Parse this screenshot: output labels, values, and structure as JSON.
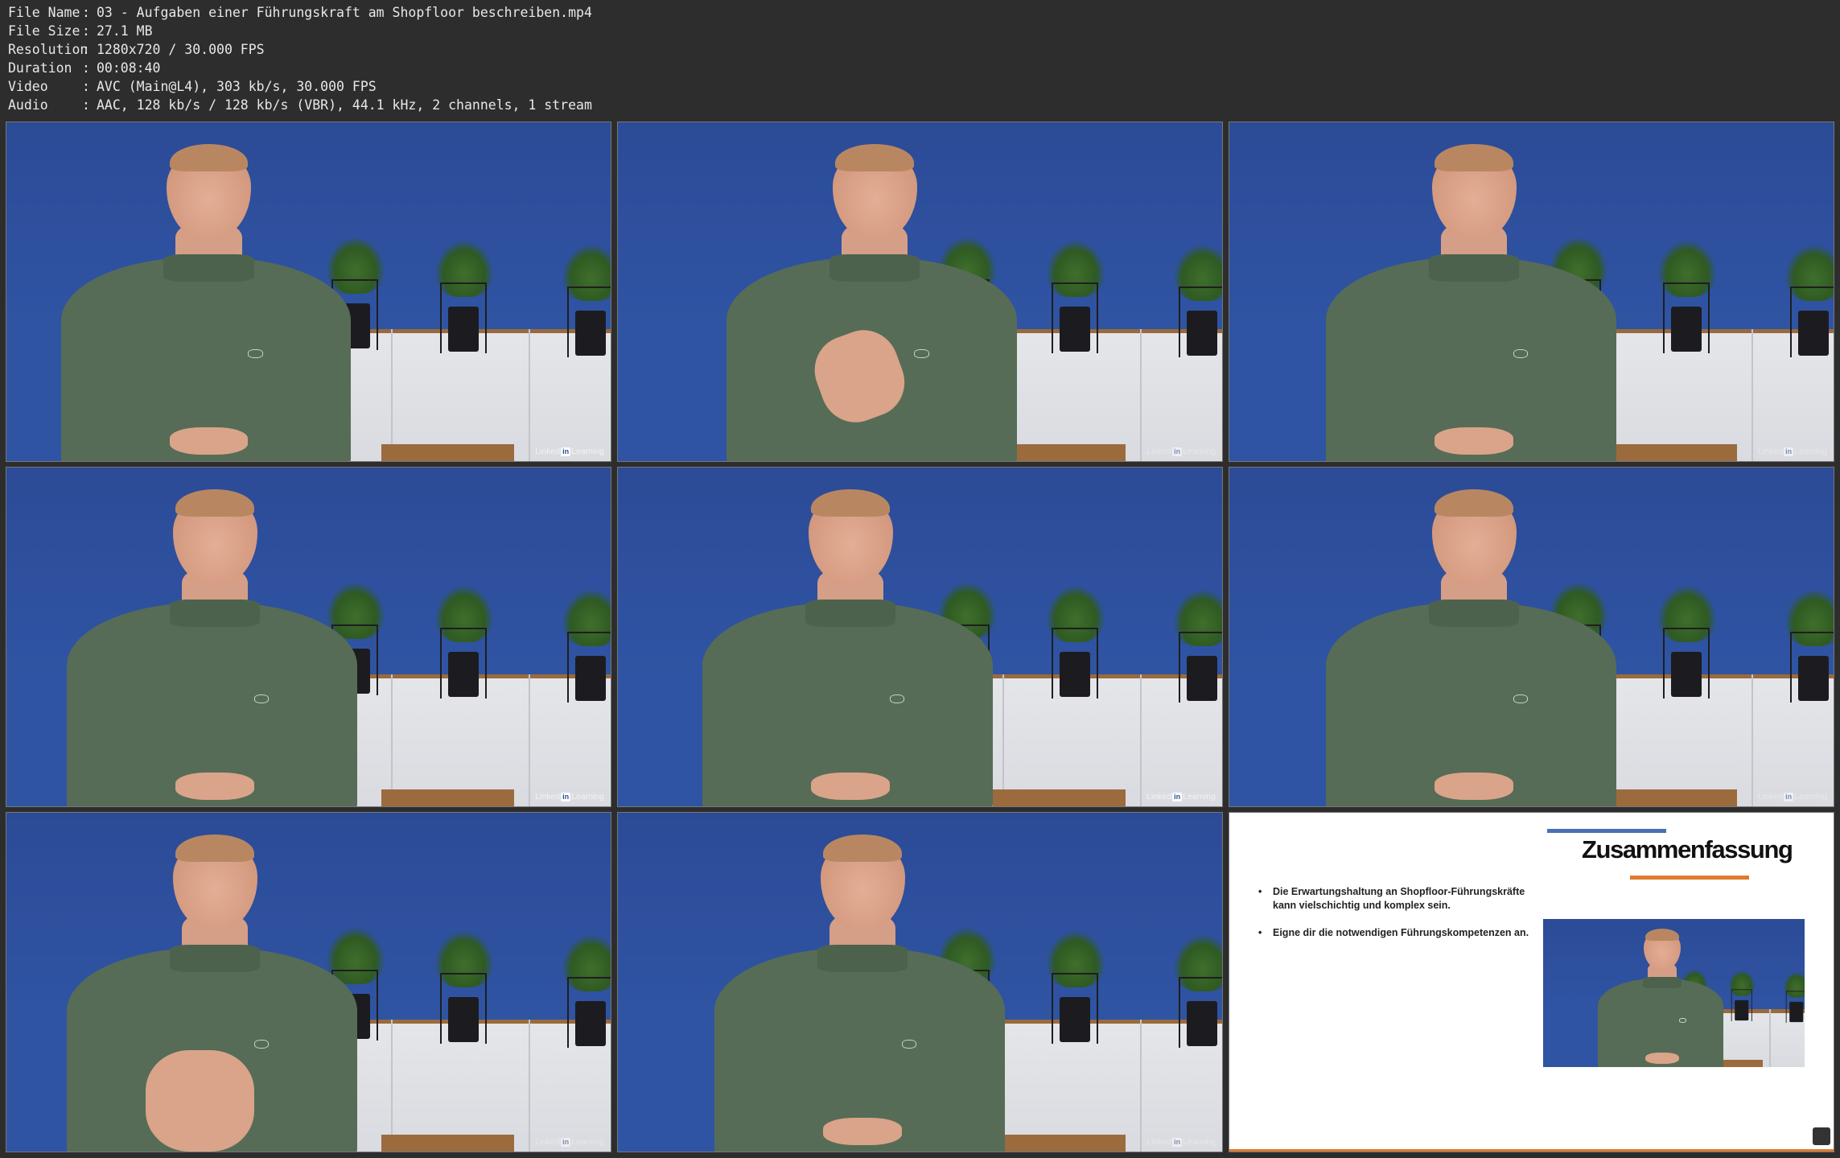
{
  "info": [
    {
      "key": "File Name",
      "value": "03 - Aufgaben einer Führungskraft am Shopfloor beschreiben.mp4"
    },
    {
      "key": "File Size",
      "value": "27.1 MB"
    },
    {
      "key": "Resolution",
      "value": "1280x720 / 30.000 FPS"
    },
    {
      "key": "Duration",
      "value": "00:08:40"
    },
    {
      "key": "Video",
      "value": "AVC (Main@L4), 303 kb/s, 30.000 FPS"
    },
    {
      "key": "Audio",
      "value": "AAC, 128 kb/s / 128 kb/s (VBR), 44.1 kHz, 2 channels, 1 stream"
    }
  ],
  "separator": ":",
  "watermark": {
    "brand_left": "Linked",
    "brand_in": "in",
    "brand_right": "Learning"
  },
  "slide": {
    "heading": "Zusammenfassung",
    "bullets": [
      "Die Erwartungshaltung an Shopfloor-Führungskräfte kann vielschichtig und komplex sein.",
      "Eigne dir die notwendigen Führungskompetenzen an."
    ],
    "bullet_symbol": "•"
  },
  "colors": {
    "background": "#2d2d2d",
    "wall_blue": "#2f54a3",
    "shirt_green": "#566c56",
    "accent_blue": "#4a6fb5",
    "accent_orange": "#e07a2e"
  }
}
